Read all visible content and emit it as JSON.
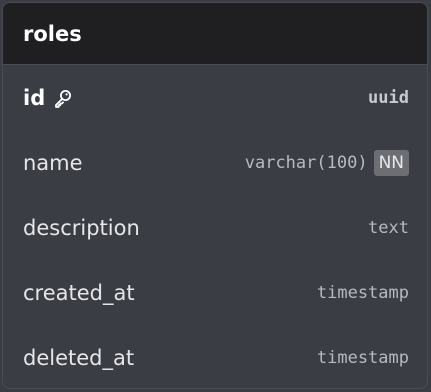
{
  "table": {
    "name": "roles",
    "columns": [
      {
        "name": "id",
        "type": "uuid",
        "primary_key": true,
        "badge": ""
      },
      {
        "name": "name",
        "type": "varchar(100)",
        "primary_key": false,
        "badge": "NN"
      },
      {
        "name": "description",
        "type": "text",
        "primary_key": false,
        "badge": ""
      },
      {
        "name": "created_at",
        "type": "timestamp",
        "primary_key": false,
        "badge": ""
      },
      {
        "name": "deleted_at",
        "type": "timestamp",
        "primary_key": false,
        "badge": ""
      }
    ]
  },
  "icons": {
    "primary_key": "key-icon"
  },
  "colors": {
    "header_bg": "#1f1f21",
    "body_bg": "#3b3d44",
    "badge_bg": "#6c6e74"
  }
}
